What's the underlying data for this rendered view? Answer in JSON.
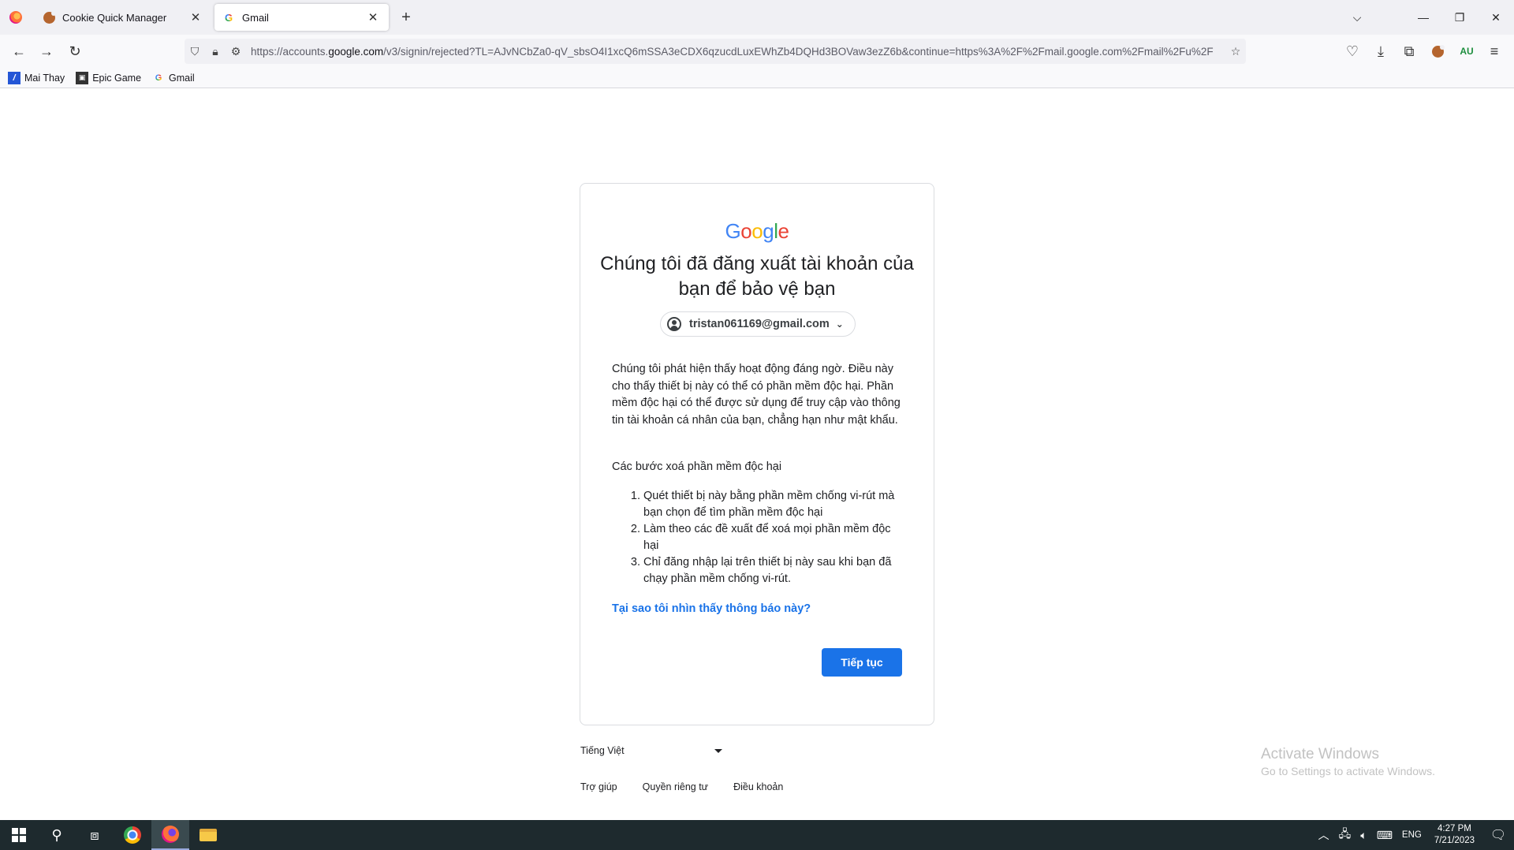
{
  "browser": {
    "tabs": [
      {
        "label": "Cookie Quick Manager",
        "active": false
      },
      {
        "label": "Gmail",
        "active": true
      }
    ],
    "url_prefix": "https://accounts.",
    "url_domain": "google.com",
    "url_rest": "/v3/signin/rejected?TL=AJvNCbZa0-qV_sbsO4I1xcQ6mSSA3eCDX6qzucdLuxEWhZb4DQHd3BOVaw3ezZ6b&continue=https%3A%2F%2Fmail.google.com%2Fmail%2Fu%2F",
    "bookmarks": [
      {
        "label": "Mai Thay",
        "icon": "mai-thay-icon"
      },
      {
        "label": "Epic Game",
        "icon": "epic-game-icon"
      },
      {
        "label": "Gmail",
        "icon": "google-icon"
      }
    ]
  },
  "page": {
    "logo": [
      "G",
      "o",
      "o",
      "g",
      "l",
      "e"
    ],
    "logo_colors": [
      "#4285f4",
      "#ea4335",
      "#fbbc05",
      "#4285f4",
      "#34a853",
      "#ea4335"
    ],
    "heading": "Chúng tôi đã đăng xuất tài khoản của bạn để bảo vệ bạn",
    "account_email": "tristan061169@gmail.com",
    "paragraph": "Chúng tôi phát hiện thấy hoạt động đáng ngờ. Điều này cho thấy thiết bị này có thể có phần mềm độc hại. Phần mềm độc hại có thể được sử dụng để truy cập vào thông tin tài khoản cá nhân của bạn, chẳng hạn như mật khẩu.",
    "steps_title": "Các bước xoá phần mềm độc hại",
    "steps": [
      "Quét thiết bị này bằng phần mềm chống vi-rút mà bạn chọn để tìm phần mềm độc hại",
      "Làm theo các đề xuất để xoá mọi phần mềm độc hại",
      "Chỉ đăng nhập lại trên thiết bị này sau khi bạn đã chạy phần mềm chống vi-rút."
    ],
    "why_link": "Tại sao tôi nhìn thấy thông báo này?",
    "continue_button": "Tiếp tục",
    "accent_color": "#1a73e8",
    "language": "Tiếng Việt",
    "footer": [
      "Trợ giúp",
      "Quyền riêng tư",
      "Điều khoản"
    ]
  },
  "watermark": {
    "line1": "Activate Windows",
    "line2": "Go to Settings to activate Windows."
  },
  "taskbar": {
    "lang": "ENG",
    "time": "4:27 PM",
    "date": "7/21/2023"
  }
}
